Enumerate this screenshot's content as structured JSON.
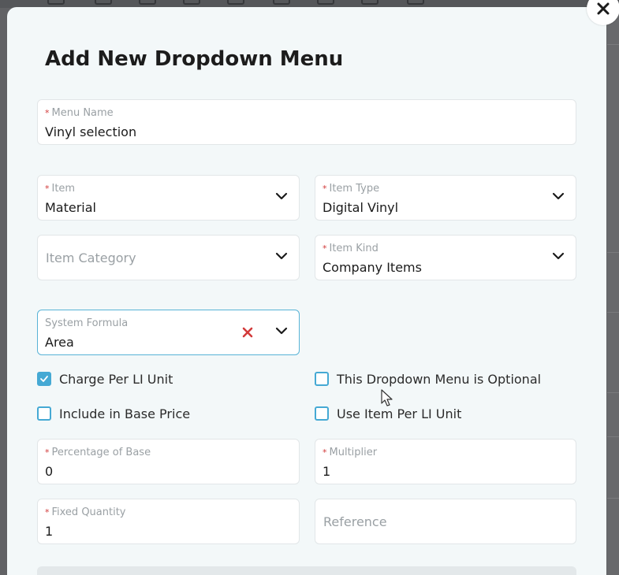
{
  "modal": {
    "title": "Add New Dropdown Menu",
    "close_icon": "close-icon"
  },
  "fields": {
    "menu_name": {
      "label": "Menu Name",
      "required": true,
      "value": "Vinyl selection"
    },
    "item": {
      "label": "Item",
      "required": true,
      "value": "Material"
    },
    "item_type": {
      "label": "Item Type",
      "required": true,
      "value": "Digital Vinyl"
    },
    "item_category": {
      "placeholder": "Item Category"
    },
    "item_kind": {
      "label": "Item Kind",
      "required": true,
      "value": "Company Items"
    },
    "system_formula": {
      "label": "System Formula",
      "value": "Area"
    },
    "percentage_of_base": {
      "label": "Percentage of Base",
      "required": true,
      "value": "0"
    },
    "multiplier": {
      "label": "Multiplier",
      "required": true,
      "value": "1"
    },
    "fixed_quantity": {
      "label": "Fixed Quantity",
      "required": true,
      "value": "1"
    },
    "reference": {
      "placeholder": "Reference"
    }
  },
  "checkboxes": {
    "charge_per_li_unit": {
      "label": "Charge Per LI Unit",
      "checked": true
    },
    "optional": {
      "label": "This Dropdown Menu is Optional",
      "checked": false
    },
    "include_in_base_price": {
      "label": "Include in Base Price",
      "checked": false
    },
    "use_item_per_li_unit": {
      "label": "Use Item Per LI Unit",
      "checked": false
    }
  },
  "required_marker": "*",
  "colors": {
    "accent": "#45a9d4",
    "required": "#d23a3a",
    "modal_bg": "#f3f8f9"
  }
}
